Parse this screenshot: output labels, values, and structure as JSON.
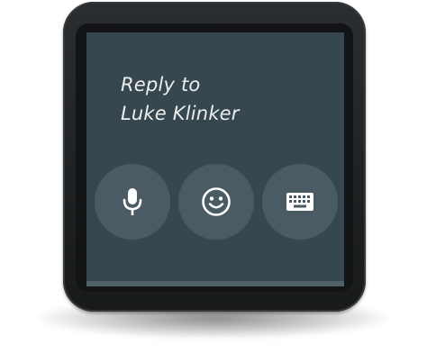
{
  "reply_screen": {
    "title_line1": "Reply to",
    "title_line2": "Luke Klinker"
  },
  "actions": [
    {
      "name": "voice-input",
      "icon": "microphone-icon"
    },
    {
      "name": "emoji-input",
      "icon": "smiley-face-icon"
    },
    {
      "name": "keyboard-input",
      "icon": "keyboard-icon"
    }
  ],
  "colors": {
    "screen_background": "#37474f",
    "button_background": "#4b5b63",
    "icon_color": "#ffffff",
    "text_color": "#eeeeee"
  }
}
